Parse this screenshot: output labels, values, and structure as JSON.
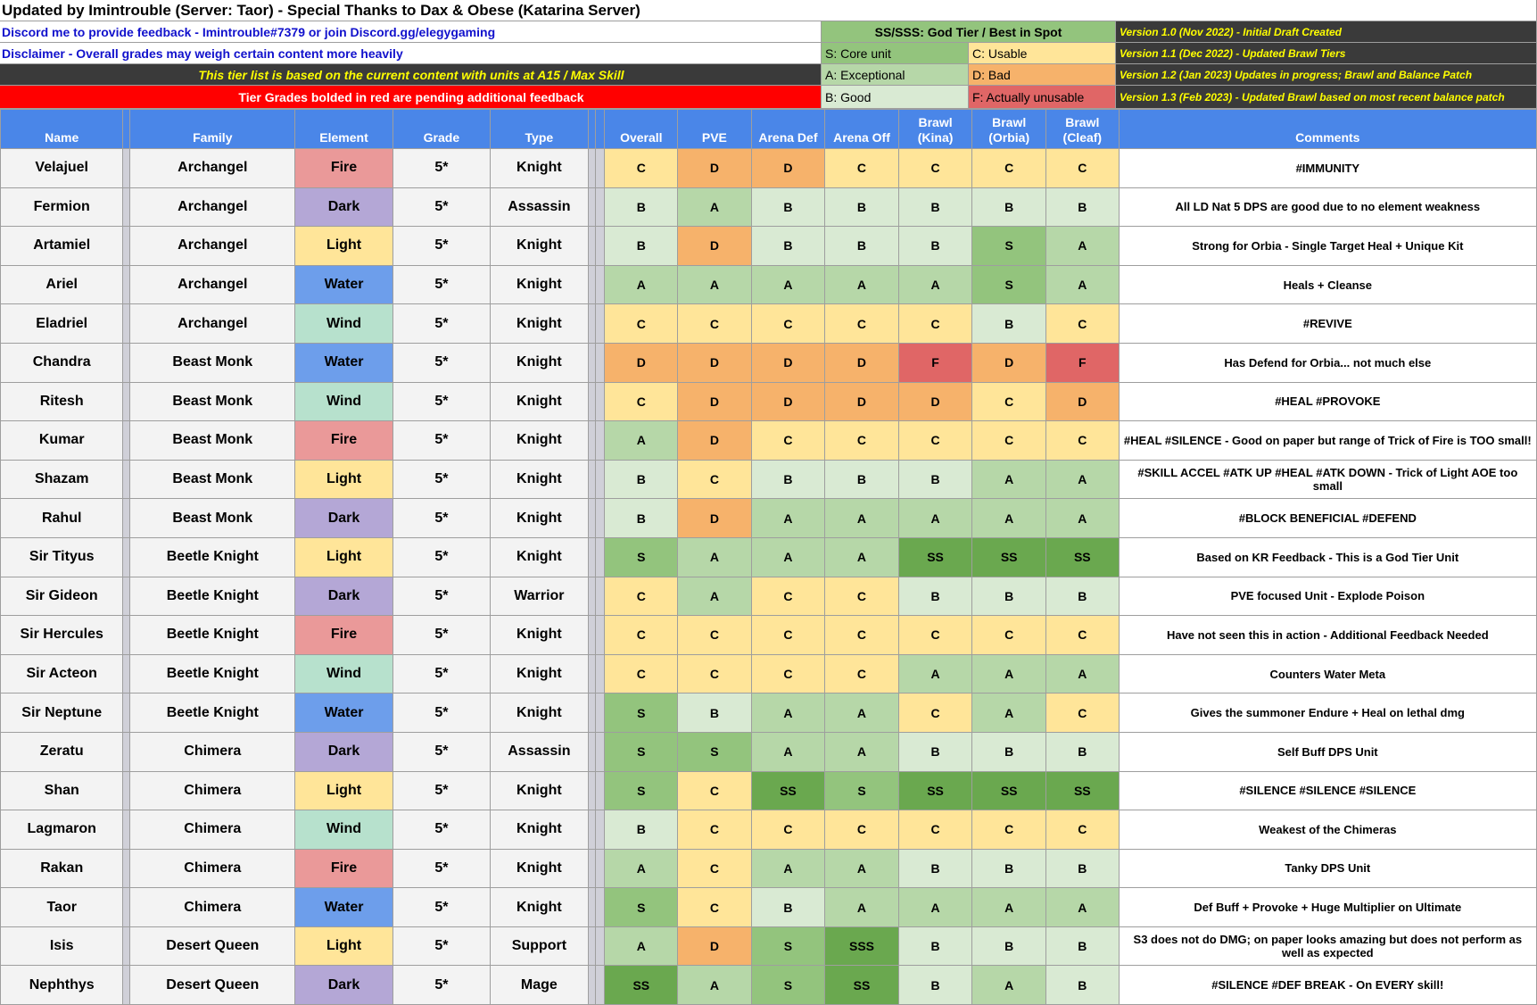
{
  "header": {
    "title": "Updated by Imintrouble (Server: Taor) - Special Thanks to Dax & Obese (Katarina Server)",
    "discord": "Discord me to provide feedback - Imintrouble#7379 or join Discord.gg/elegygaming",
    "disclaimer": "Disclaimer - Overall grades may weigh certain content more heavily",
    "banner": "This tier list is based on the current content with units at A15 / Max Skill",
    "red_note": "Tier Grades bolded in red are pending additional feedback"
  },
  "legend": {
    "ss": "SS/SSS: God Tier / Best in Spot",
    "s": "S: Core unit",
    "c": "C: Usable",
    "a": "A: Exceptional",
    "d": "D: Bad",
    "b": "B: Good",
    "f": "F: Actually unusable"
  },
  "versions": [
    "Version 1.0 (Nov 2022) - Initial Draft Created",
    "Version 1.1 (Dec 2022) - Updated Brawl Tiers",
    "Version 1.2 (Jan 2023) Updates in progress; Brawl and Balance Patch",
    "Version 1.3 (Feb 2023) - Updated Brawl based on most recent balance patch"
  ],
  "columns": {
    "name": "Name",
    "family": "Family",
    "element": "Element",
    "grade": "Grade",
    "type": "Type",
    "overall": "Overall",
    "pve": "PVE",
    "arena_def": "Arena Def",
    "arena_off": "Arena Off",
    "brawl_kina_1": "Brawl",
    "brawl_kina_2": "(Kina)",
    "brawl_orbia_1": "Brawl",
    "brawl_orbia_2": "(Orbia)",
    "brawl_cleaf_1": "Brawl",
    "brawl_cleaf_2": "(Cleaf)",
    "comments": "Comments"
  },
  "element_colors": {
    "Fire": "#ea9999",
    "Dark": "#b4a7d6",
    "Light": "#ffe599",
    "Water": "#6d9eeb",
    "Wind": "#b7e1cd"
  },
  "grade_colors": {
    "SSS": "#6aa84f",
    "SS": "#6aa84f",
    "S": "#93c47d",
    "A": "#b6d7a8",
    "B": "#d9ead3",
    "C": "#ffe599",
    "D": "#f6b26b",
    "F": "#e06666"
  },
  "rows": [
    {
      "name": "Velajuel",
      "family": "Archangel",
      "element": "Fire",
      "grade": "5*",
      "type": "Knight",
      "g": [
        "C",
        "D",
        "D",
        "C",
        "C",
        "C",
        "C"
      ],
      "comment": "#IMMUNITY"
    },
    {
      "name": "Fermion",
      "family": "Archangel",
      "element": "Dark",
      "grade": "5*",
      "type": "Assassin",
      "g": [
        "B",
        "A",
        "B",
        "B",
        "B",
        "B",
        "B"
      ],
      "comment": "All LD Nat 5 DPS are good due to no element weakness"
    },
    {
      "name": "Artamiel",
      "family": "Archangel",
      "element": "Light",
      "grade": "5*",
      "type": "Knight",
      "g": [
        "B",
        "D",
        "B",
        "B",
        "B",
        "S",
        "A"
      ],
      "comment": "Strong for Orbia - Single Target Heal + Unique Kit"
    },
    {
      "name": "Ariel",
      "family": "Archangel",
      "element": "Water",
      "grade": "5*",
      "type": "Knight",
      "g": [
        "A",
        "A",
        "A",
        "A",
        "A",
        "S",
        "A"
      ],
      "comment": "Heals + Cleanse"
    },
    {
      "name": "Eladriel",
      "family": "Archangel",
      "element": "Wind",
      "grade": "5*",
      "type": "Knight",
      "g": [
        "C",
        "C",
        "C",
        "C",
        "C",
        "B",
        "C"
      ],
      "comment": "#REVIVE"
    },
    {
      "name": "Chandra",
      "family": "Beast Monk",
      "element": "Water",
      "grade": "5*",
      "type": "Knight",
      "g": [
        "D",
        "D",
        "D",
        "D",
        "F",
        "D",
        "F"
      ],
      "comment": "Has Defend for Orbia... not much else"
    },
    {
      "name": "Ritesh",
      "family": "Beast Monk",
      "element": "Wind",
      "grade": "5*",
      "type": "Knight",
      "g": [
        "C",
        "D",
        "D",
        "D",
        "D",
        "C",
        "D"
      ],
      "comment": "#HEAL #PROVOKE"
    },
    {
      "name": "Kumar",
      "family": "Beast Monk",
      "element": "Fire",
      "grade": "5*",
      "type": "Knight",
      "g": [
        "A",
        "D",
        "C",
        "C",
        "C",
        "C",
        "C"
      ],
      "comment": "#HEAL #SILENCE - Good on paper but range of Trick of Fire is TOO small!"
    },
    {
      "name": "Shazam",
      "family": "Beast Monk",
      "element": "Light",
      "grade": "5*",
      "type": "Knight",
      "g": [
        "B",
        "C",
        "B",
        "B",
        "B",
        "A",
        "A"
      ],
      "comment": "#SKILL ACCEL #ATK UP #HEAL #ATK DOWN - Trick of Light AOE too small"
    },
    {
      "name": "Rahul",
      "family": "Beast Monk",
      "element": "Dark",
      "grade": "5*",
      "type": "Knight",
      "g": [
        "B",
        "D",
        "A",
        "A",
        "A",
        "A",
        "A"
      ],
      "comment": "#BLOCK BENEFICIAL #DEFEND"
    },
    {
      "name": "Sir Tityus",
      "family": "Beetle Knight",
      "element": "Light",
      "grade": "5*",
      "type": "Knight",
      "g": [
        "S",
        "A",
        "A",
        "A",
        "SS",
        "SS",
        "SS"
      ],
      "comment": "Based on KR Feedback - This is a God Tier Unit"
    },
    {
      "name": "Sir Gideon",
      "family": "Beetle Knight",
      "element": "Dark",
      "grade": "5*",
      "type": "Warrior",
      "g": [
        "C",
        "A",
        "C",
        "C",
        "B",
        "B",
        "B"
      ],
      "comment": "PVE focused Unit - Explode Poison"
    },
    {
      "name": "Sir Hercules",
      "family": "Beetle Knight",
      "element": "Fire",
      "grade": "5*",
      "type": "Knight",
      "g": [
        "C",
        "C",
        "C",
        "C",
        "C",
        "C",
        "C"
      ],
      "comment": "Have not seen this in action -  Additional Feedback Needed"
    },
    {
      "name": "Sir Acteon",
      "family": "Beetle Knight",
      "element": "Wind",
      "grade": "5*",
      "type": "Knight",
      "g": [
        "C",
        "C",
        "C",
        "C",
        "A",
        "A",
        "A"
      ],
      "comment": "Counters Water Meta"
    },
    {
      "name": "Sir Neptune",
      "family": "Beetle Knight",
      "element": "Water",
      "grade": "5*",
      "type": "Knight",
      "g": [
        "S",
        "B",
        "A",
        "A",
        "C",
        "A",
        "C"
      ],
      "comment": "Gives the summoner Endure +  Heal on lethal dmg"
    },
    {
      "name": "Zeratu",
      "family": "Chimera",
      "element": "Dark",
      "grade": "5*",
      "type": "Assassin",
      "g": [
        "S",
        "S",
        "A",
        "A",
        "B",
        "B",
        "B"
      ],
      "comment": "Self Buff DPS Unit"
    },
    {
      "name": "Shan",
      "family": "Chimera",
      "element": "Light",
      "grade": "5*",
      "type": "Knight",
      "g": [
        "S",
        "C",
        "SS",
        "S",
        "SS",
        "SS",
        "SS"
      ],
      "comment": "#SILENCE #SILENCE #SILENCE"
    },
    {
      "name": "Lagmaron",
      "family": "Chimera",
      "element": "Wind",
      "grade": "5*",
      "type": "Knight",
      "g": [
        "B",
        "C",
        "C",
        "C",
        "C",
        "C",
        "C"
      ],
      "comment": "Weakest of the Chimeras"
    },
    {
      "name": "Rakan",
      "family": "Chimera",
      "element": "Fire",
      "grade": "5*",
      "type": "Knight",
      "g": [
        "A",
        "C",
        "A",
        "A",
        "B",
        "B",
        "B"
      ],
      "comment": "Tanky DPS Unit"
    },
    {
      "name": "Taor",
      "family": "Chimera",
      "element": "Water",
      "grade": "5*",
      "type": "Knight",
      "g": [
        "S",
        "C",
        "B",
        "A",
        "A",
        "A",
        "A"
      ],
      "comment": "Def Buff + Provoke + Huge Multiplier on Ultimate"
    },
    {
      "name": "Isis",
      "family": "Desert Queen",
      "element": "Light",
      "grade": "5*",
      "type": "Support",
      "g": [
        "A",
        "D",
        "S",
        "SSS",
        "B",
        "B",
        "B"
      ],
      "comment": "S3 does not do DMG; on paper looks amazing but does not perform as well as expected"
    },
    {
      "name": "Nephthys",
      "family": "Desert Queen",
      "element": "Dark",
      "grade": "5*",
      "type": "Mage",
      "g": [
        "SS",
        "A",
        "S",
        "SS",
        "B",
        "A",
        "B"
      ],
      "comment": "#SILENCE #DEF BREAK - On EVERY skill!"
    }
  ]
}
